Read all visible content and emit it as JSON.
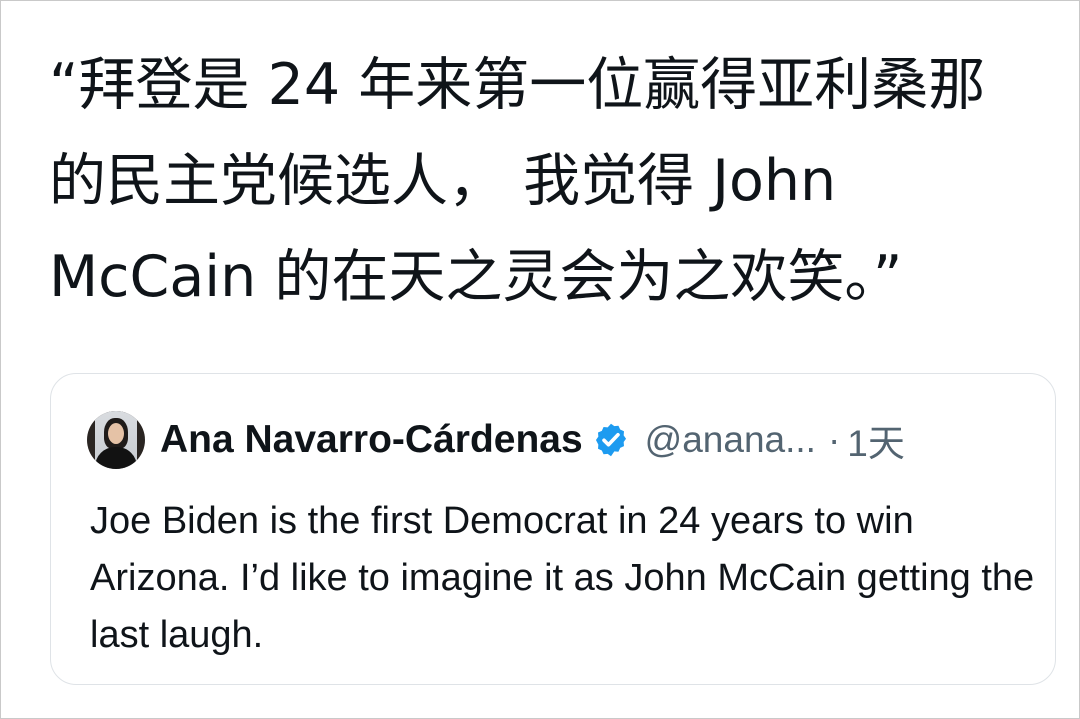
{
  "tweet": {
    "text": "“拜登是 24 年来第一位赢得亚利桑那的民主党候选人， 我觉得 John McCain 的在天之灵会为之欢笑。”"
  },
  "quoted_tweet": {
    "display_name": "Ana Navarro-Cárdenas",
    "handle": "@anana...",
    "separator": "·",
    "time": "1天",
    "text": "Joe Biden is the first Democrat in 24 years to win Arizona. I’d like to imagine it as John McCain getting the last laugh.",
    "avatar": "profile-photo-woman",
    "verified_icon": "verified-badge-icon"
  },
  "colors": {
    "text": "#0f1419",
    "secondary": "#536471",
    "verified": "#1d9bf0",
    "card_border": "#dfe3e7"
  }
}
